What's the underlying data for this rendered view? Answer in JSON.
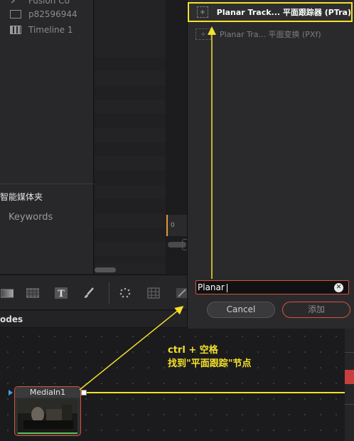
{
  "media_pool": {
    "clips": [
      {
        "icon": "fusion-comp-icon",
        "label": "Fusion Co"
      },
      {
        "icon": "clip-icon",
        "label": "p82596944"
      },
      {
        "icon": "timeline-icon",
        "label": "Timeline 1"
      }
    ],
    "smart_bin_label": "智能媒体夹",
    "keywords_label": "Keywords"
  },
  "viewer": {
    "timecode_zero": "0"
  },
  "toolbar": {
    "icons": [
      "gradient-icon",
      "checker-icon",
      "text-icon",
      "paint-brush-icon",
      "particles-icon",
      "grid-warp-icon",
      "paint-stroke-icon"
    ]
  },
  "nodes": {
    "title": "odes",
    "media_in_label": "MediaIn1"
  },
  "select_tool": {
    "results": [
      {
        "label": "Planar Track... 平面跟踪器 (PTra)",
        "icon": "planar-tracker-node-icon",
        "selected": true
      },
      {
        "label": "Planar Tra... 平面变换 (PXf)",
        "icon": "planar-transform-node-icon",
        "selected": false
      }
    ],
    "search_value": "Planar",
    "cancel_label": "Cancel",
    "add_label": "添加"
  },
  "annotation": {
    "line1": "ctrl + 空格",
    "line2": "找到\"平面跟踪\"节点",
    "color": "#f4e12c"
  },
  "colors": {
    "accent_red": "#d8523c",
    "highlight_yellow": "#f4e12c",
    "input_arrow_blue": "#3aa4e6",
    "node_green": "#5cbf5c"
  }
}
